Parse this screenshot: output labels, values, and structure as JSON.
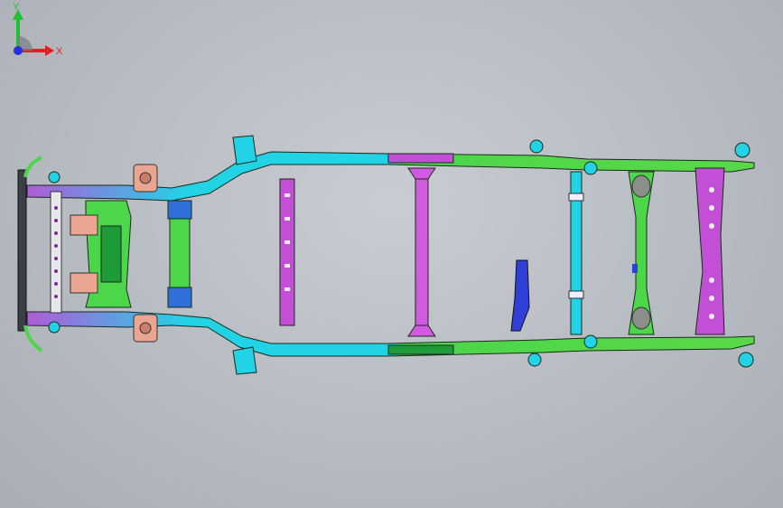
{
  "viewport": {
    "background": "#b9bdc4"
  },
  "model": {
    "colors": {
      "rail_cyan": "#22d3e6",
      "rail_green": "#4cd64a",
      "crossmember_magenta": "#c24fd6",
      "crossmember_blue": "#2f3fd8",
      "bracket_salmon": "#e9a58f",
      "edge": "#1a2a1a"
    }
  },
  "triad": {
    "x_label": "X",
    "y_label": "Y",
    "x_color": "#e02020",
    "y_color": "#20c030",
    "z_color": "#2030e0"
  }
}
